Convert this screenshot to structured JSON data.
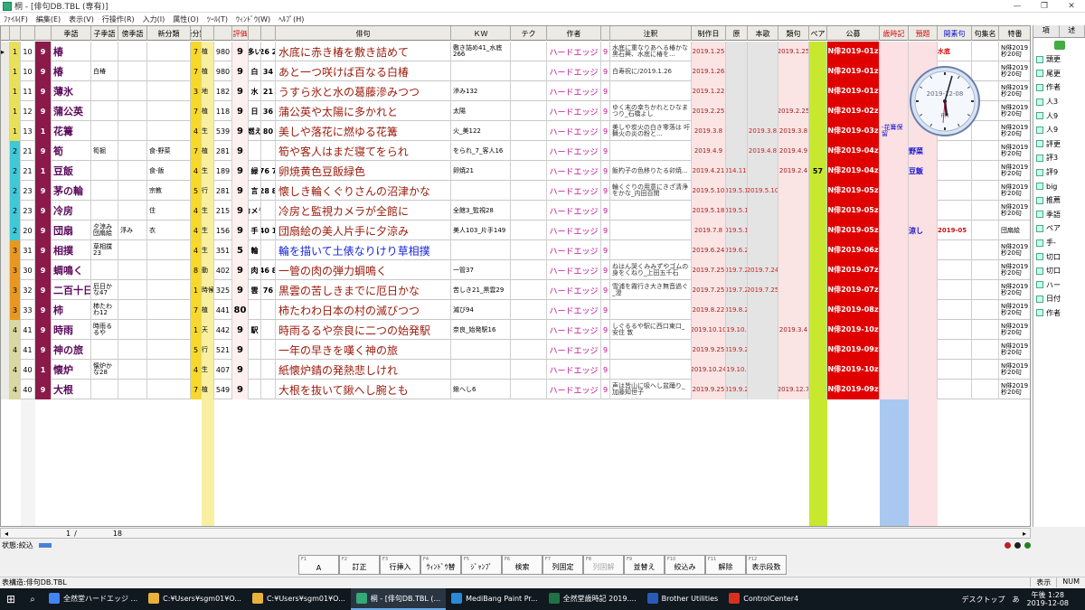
{
  "window": {
    "title": "桐 - [俳句DB.TBL (専有)]"
  },
  "menu": [
    "ﾌｧｲﾙ(F)",
    "編集(E)",
    "表示(V)",
    "行操作(R)",
    "入力(I)",
    "属性(O)",
    "ﾂｰﾙ(T)",
    "ｳｨﾝﾄﾞｳ(W)",
    "ﾍﾙﾌﾟ(H)"
  ],
  "columns": {
    "kigo": "季語",
    "kodai": "子季語",
    "bou": "傍季語",
    "bunrui": "新分類",
    "bunrui2": "新分類",
    "hyoka": "評価",
    "haiku": "俳句",
    "kw": "ＫＷ",
    "tech": "テク",
    "sakusha": "作者",
    "chushaku": "注釈",
    "sakusei": "制作日",
    "gen": "原",
    "honka": "本歌",
    "ruiku": "類句",
    "pair": "ペア",
    "koubo": "公募",
    "saijiki": "歳時記",
    "yodai": "預題",
    "kaiso": "開素句",
    "kushu": "句集名",
    "tokuban": "特番"
  },
  "rows": [
    {
      "a": "1",
      "b": "10",
      "k": "9",
      "kigo": "椿",
      "s1": "",
      "s2": "",
      "s3": "",
      "n": "7",
      "cat": "植",
      "cn": "980",
      "h": "9",
      "m1": "多い",
      "m2": "26 2",
      "haiku": "水底に赤き椿を敷き詰めて",
      "kw": "敷き詰め41_水底266",
      "sak": "ハードエッジ",
      "sn": "9",
      "chu": "水底に重なりあへる椿かな 黒石興、水底に椿を...",
      "date": "2019.1.25",
      "gen": "",
      "honka": "",
      "rui": "2019.1.25",
      "pair": "",
      "koubo": "N俳2019-01z",
      "sai": "",
      "yodai": "",
      "kaiso": "水底",
      "toku": "N俳2019秒20句"
    },
    {
      "a": "1",
      "b": "10",
      "k": "9",
      "kigo": "椿",
      "s1": "白椿",
      "s2": "",
      "s3": "",
      "n": "7",
      "cat": "植",
      "cn": "980",
      "h": "9",
      "m1": "白",
      "m2": "34",
      "haiku": "あと一つ咲けば百なる白椿",
      "kw": "",
      "sak": "ハードエッジ",
      "sn": "9",
      "chu": "白寿祝に/2019.1.26",
      "date": "2019.1.26",
      "gen": "",
      "honka": "",
      "rui": "",
      "pair": "",
      "koubo": "N俳2019-01z",
      "sai": "",
      "yodai": "",
      "kaiso": "",
      "toku": "N俳2019秒20句"
    },
    {
      "a": "1",
      "b": "11",
      "k": "9",
      "kigo": "薄氷",
      "s1": "",
      "s2": "",
      "s3": "",
      "n": "3",
      "cat": "地",
      "cn": "182",
      "h": "9",
      "m1": "水",
      "m2": "21",
      "haiku": "うすら氷と水の葛藤滲みつつ",
      "kw": "滲み132",
      "sak": "ハードエッジ",
      "sn": "9",
      "chu": "",
      "date": "2019.1.22",
      "gen": "",
      "honka": "",
      "rui": "",
      "pair": "",
      "koubo": "N俳2019-01z",
      "sai": "",
      "yodai": "",
      "kaiso": "",
      "toku": "N俳2019秒20句"
    },
    {
      "a": "1",
      "b": "12",
      "k": "9",
      "kigo": "蒲公英",
      "s1": "",
      "s2": "",
      "s3": "",
      "n": "7",
      "cat": "植",
      "cn": "118",
      "h": "9",
      "m1": "日",
      "m2": "36",
      "haiku": "蒲公英や太陽に多かれと",
      "kw": "太陽",
      "sak": "ハードエッジ",
      "sn": "9",
      "chu": "ゆく末の幸ちかれとひなまつり_石橋よし",
      "date": "2019.2.25",
      "gen": "",
      "honka": "",
      "rui": "2019.2.25",
      "pair": "",
      "koubo": "N俳2019-02z",
      "sai": "",
      "yodai": "",
      "kaiso": "",
      "toku": "N俳2019秒20句"
    },
    {
      "a": "1",
      "b": "13",
      "k": "1",
      "kigo": "花篝",
      "s1": "",
      "s2": "",
      "s3": "",
      "n": "4",
      "cat": "生",
      "cn": "539",
      "h": "9",
      "m1": "燃え",
      "m2": "80",
      "haiku": "美しや落花に燃ゆる花篝",
      "kw": "火_美122",
      "sak": "ハードエッジ",
      "sn": "9",
      "chu": "美しや炭火の白き零落は 吁 舞火の炎の粉と...",
      "date": "2019.3.8",
      "gen": "",
      "honka": "2019.3.8",
      "rui": "2019.3.8",
      "pair": "",
      "koubo": "N俳2019-03z",
      "sai": "-花篝保留",
      "yodai": "",
      "kaiso": "",
      "toku": "N俳2019秒20句"
    },
    {
      "a": "2",
      "b": "21",
      "k": "9",
      "kigo": "筍",
      "s1": "筍掘",
      "s2": "",
      "s3": "食-野菜",
      "n": "7",
      "cat": "植",
      "cn": "281",
      "h": "9",
      "m1": "",
      "m2": "",
      "haiku": "筍や客人はまだ寝てをられ",
      "kw": "をられ_7_客人16",
      "sak": "ハードエッジ",
      "sn": "9",
      "chu": "",
      "date": "2019.4.9",
      "gen": "",
      "honka": "2019.4.8",
      "rui": "2019.4.9",
      "pair": "",
      "koubo": "N俳2019-04z",
      "sai": "",
      "yodai": "野菜",
      "kaiso": "",
      "toku": "N俳2019秒20句"
    },
    {
      "a": "2",
      "b": "21",
      "k": "1",
      "kigo": "豆飯",
      "s1": "",
      "s2": "",
      "s3": "食-飯",
      "n": "4",
      "cat": "生",
      "cn": "189",
      "h": "9",
      "m1": "緑",
      "m2": "76 7",
      "haiku": "卵焼黄色豆飯緑色",
      "kw": "卵焼21",
      "sak": "ハードエッジ",
      "sn": "9",
      "chu": "飯杓子の色移りたる卯焼...",
      "date": "2019.4.21",
      "gen": "2014.11.1",
      "honka": "",
      "rui": "2019.2.4",
      "pair": "57",
      "koubo": "N俳2019-04z",
      "sai": "",
      "yodai": "豆飯",
      "kaiso": "",
      "toku": "N俳2019秒20句"
    },
    {
      "a": "2",
      "b": "23",
      "k": "9",
      "kigo": "茅の輪",
      "s1": "",
      "s2": "",
      "s3": "宗教",
      "n": "5",
      "cat": "行",
      "cn": "281",
      "h": "9",
      "m1": "言",
      "m2": "28 8",
      "haiku": "懐しき輪くぐりさんの沼津かな",
      "kw": "",
      "sak": "ハードエッジ",
      "sn": "9",
      "chu": "輪くぐりの用意にきざ清浄をかな_内田百閒",
      "date": "2019.5.10",
      "gen": "2019.5.10",
      "honka": "2019.5.10",
      "rui": "",
      "pair": "",
      "koubo": "N俳2019-05z",
      "sai": "",
      "yodai": "",
      "kaiso": "",
      "toku": "N俳2019秒20句"
    },
    {
      "a": "2",
      "b": "23",
      "k": "9",
      "kigo": "冷房",
      "s1": "",
      "s2": "",
      "s3": "住",
      "n": "4",
      "cat": "生",
      "cn": "215",
      "h": "9",
      "m1": "カメラ",
      "m2": "",
      "haiku": "冷房と監視カメラが全館に",
      "kw": "全館3_監視28",
      "sak": "ハードエッジ",
      "sn": "9",
      "chu": "",
      "date": "2019.5.18",
      "gen": "2019.5.18",
      "honka": "",
      "rui": "",
      "pair": "",
      "koubo": "N俳2019-05z",
      "sai": "",
      "yodai": "",
      "kaiso": "",
      "toku": "N俳2019秒20句"
    },
    {
      "a": "2",
      "b": "20",
      "k": "9",
      "kigo": "団扇",
      "s1": "夕涼み 団扇絵",
      "s2": "浮み",
      "s3": "衣",
      "n": "4",
      "cat": "生",
      "cn": "156",
      "h": "9",
      "m1": "手",
      "m2": "40 1",
      "haiku": "団扇絵の美人片手に夕涼み",
      "kw": "美人103_片手149",
      "sak": "ハードエッジ",
      "sn": "9",
      "chu": "",
      "date": "2019.7.8",
      "gen": "2019.5.12",
      "honka": "",
      "rui": "",
      "pair": "",
      "koubo": "N俳2019-05z",
      "sai": "",
      "yodai": "涼し",
      "kaiso": "2019-05",
      "toku": "団扇絵"
    },
    {
      "a": "3",
      "b": "31",
      "k": "9",
      "kigo": "相撲",
      "s1": "草相撲23",
      "s2": "",
      "s3": "",
      "n": "4",
      "cat": "生",
      "cn": "351",
      "h": "5",
      "m1": "輪",
      "m2": "",
      "haiku": "輪を描いて土俵なりけり草相撲",
      "kw": "",
      "sak": "ハードエッジ",
      "sn": "9",
      "chu": "",
      "date": "2019.6.24",
      "gen": "2019.6.24",
      "honka": "",
      "rui": "",
      "pair": "",
      "koubo": "N俳2019-06z",
      "sai": "",
      "yodai": "",
      "kaiso": "",
      "toku": "N俳2019秒20句"
    },
    {
      "a": "3",
      "b": "30",
      "k": "9",
      "kigo": "蜩鳴く",
      "s1": "",
      "s2": "",
      "s3": "",
      "n": "8",
      "cat": "動",
      "cn": "402",
      "h": "9",
      "m1": "肉",
      "m2": "46 8",
      "haiku": "一管の肉の弾力蜩鳴く",
      "kw": "一管37",
      "sak": "ハードエッジ",
      "sn": "9",
      "chu": "ねはん哭くみみずやゴムの身をくねり_上田五千石",
      "date": "2019.7.25",
      "gen": "2019.7.24",
      "honka": "2019.7.24",
      "rui": "",
      "pair": "",
      "koubo": "N俳2019-07z",
      "sai": "",
      "yodai": "",
      "kaiso": "",
      "toku": "N俳2019秒20句"
    },
    {
      "a": "3",
      "b": "32",
      "k": "9",
      "kigo": "二百十日",
      "s1": "厄日かな47",
      "s2": "",
      "s3": "",
      "n": "1",
      "cat": "時候",
      "cn": "325",
      "h": "9",
      "m1": "雲",
      "m2": "76",
      "haiku": "黒雲の苦しきまでに厄日かな",
      "kw": "苦しき21_黒雲29",
      "sak": "ハードエッジ",
      "sn": "9",
      "chu": "雪浦を霧行き大き無音過ぐ_澄",
      "date": "2019.7.25",
      "gen": "2019.7.25",
      "honka": "2019.7.25",
      "rui": "",
      "pair": "",
      "koubo": "N俳2019-07z",
      "sai": "",
      "yodai": "",
      "kaiso": "",
      "toku": "N俳2019秒20句"
    },
    {
      "a": "3",
      "b": "33",
      "k": "9",
      "kigo": "柿",
      "s1": "柿たわわ12",
      "s2": "",
      "s3": "",
      "n": "7",
      "cat": "植",
      "cn": "441",
      "h": "80",
      "m1": "",
      "m2": "",
      "haiku": "柿たわわ日本の村の滅びつつ",
      "kw": "滅び94",
      "sak": "ハードエッジ",
      "sn": "9",
      "chu": "",
      "date": "2019.8.22",
      "gen": "2019.8.22",
      "honka": "",
      "rui": "",
      "pair": "",
      "koubo": "N俳2019-08z",
      "sai": "",
      "yodai": "",
      "kaiso": "",
      "toku": "N俳2019秒20句"
    },
    {
      "a": "4",
      "b": "41",
      "k": "9",
      "kigo": "時雨",
      "s1": "時雨るるや",
      "s2": "",
      "s3": "",
      "n": "1",
      "cat": "天",
      "cn": "442",
      "h": "9",
      "m1": "駅",
      "m2": "",
      "haiku": "時雨るるや奈良に二つの始発駅",
      "kw": "奈良_始発駅16",
      "sak": "ハードエッジ",
      "sn": "9",
      "chu": "しぐるるや駅に西口東口_安住 敦",
      "date": "2019.10.10",
      "gen": "2019.10.10",
      "honka": "",
      "rui": "2019.3.4",
      "pair": "",
      "koubo": "N俳2019-10z",
      "sai": "",
      "yodai": "",
      "kaiso": "",
      "toku": "N俳2019秒20句"
    },
    {
      "a": "4",
      "b": "41",
      "k": "9",
      "kigo": "神の旅",
      "s1": "",
      "s2": "",
      "s3": "",
      "n": "5",
      "cat": "行",
      "cn": "521",
      "h": "9",
      "m1": "",
      "m2": "",
      "haiku": "一年の早きを嘆く神の旅",
      "kw": "",
      "sak": "ハードエッジ",
      "sn": "9",
      "chu": "",
      "date": "2019.9.25",
      "gen": "2019.9.25",
      "honka": "",
      "rui": "",
      "pair": "",
      "koubo": "N俳2019-09z",
      "sai": "",
      "yodai": "",
      "kaiso": "",
      "toku": "N俳2019秒20句"
    },
    {
      "a": "4",
      "b": "40",
      "k": "1",
      "kigo": "懐炉",
      "s1": "懐炉かな28",
      "s2": "",
      "s3": "",
      "n": "4",
      "cat": "生",
      "cn": "407",
      "h": "9",
      "m1": "",
      "m2": "",
      "haiku": "紙懐炉錆の発熱悲しけれ",
      "kw": "",
      "sak": "ハードエッジ",
      "sn": "9",
      "chu": "",
      "date": "2019.10.24",
      "gen": "2019.10.23",
      "honka": "",
      "rui": "",
      "pair": "",
      "koubo": "N俳2019-10z",
      "sai": "",
      "yodai": "",
      "kaiso": "",
      "toku": "N俳2019秒20句"
    },
    {
      "a": "4",
      "b": "40",
      "k": "9",
      "kigo": "大根",
      "s1": "",
      "s2": "",
      "s3": "",
      "n": "7",
      "cat": "植",
      "cn": "549",
      "h": "9",
      "m1": "",
      "m2": "",
      "haiku": "大根を抜いて鍬へし腕とも",
      "kw": "鍬へし6",
      "sak": "ハードエッジ",
      "sn": "9",
      "chu": "声は皆山に吸へし盆踊り_加藤知世子",
      "date": "2019.9.25",
      "gen": "2019.9.25",
      "honka": "",
      "rui": "2019.12.7",
      "pair": "",
      "koubo": "N俳2019-09z",
      "sai": "",
      "yodai": "",
      "kaiso": "",
      "toku": "N俳2019秒20句"
    }
  ],
  "sidebar": {
    "tabs": [
      "項",
      "述"
    ],
    "items": [
      "頭更",
      "尾更",
      "作者",
      "人3",
      "人9",
      "人9",
      "評更",
      "評3",
      "評9",
      "big",
      "推薦",
      "季語",
      "ペア",
      "手-",
      "切口",
      "切口",
      "ハー",
      "日付",
      "作者"
    ]
  },
  "clock": {
    "date": "2019-12-08",
    "period": "PM"
  },
  "nav": {
    "current": "1",
    "sep": "/",
    "total": "18"
  },
  "status": {
    "left": "状態:絞込",
    "table": "表構造:俳句DB.TBL"
  },
  "fkeys": [
    {
      "n": "F1",
      "l": "A",
      "d": false
    },
    {
      "n": "F2",
      "l": "訂正",
      "d": false
    },
    {
      "n": "F3",
      "l": "行挿入",
      "d": false
    },
    {
      "n": "F4",
      "l": "ｳｨﾝﾄﾞｳ替",
      "d": false
    },
    {
      "n": "F5",
      "l": "ｼﾞｬﾝﾌﾟ",
      "d": false
    },
    {
      "n": "F6",
      "l": "検索",
      "d": false
    },
    {
      "n": "F7",
      "l": "列固定",
      "d": false
    },
    {
      "n": "F8",
      "l": "列固解",
      "d": true
    },
    {
      "n": "F9",
      "l": "並替え",
      "d": false
    },
    {
      "n": "F10",
      "l": "絞込み",
      "d": false
    },
    {
      "n": "F11",
      "l": "解除",
      "d": false
    },
    {
      "n": "F12",
      "l": "表示段数",
      "d": false
    }
  ],
  "bottom": {
    "right": [
      "表示",
      "NUM"
    ]
  },
  "taskbar": {
    "items": [
      {
        "l": "全然堂ハードエッジ ...",
        "c": "#4285f4",
        "a": false
      },
      {
        "l": "C:¥Users¥sgm01¥O...",
        "c": "#e8b13a",
        "a": false
      },
      {
        "l": "C:¥Users¥sgm01¥O...",
        "c": "#e8b13a",
        "a": false
      },
      {
        "l": "桐 - [俳句DB.TBL (...",
        "c": "#3a7",
        "a": true
      },
      {
        "l": "MediBang Paint Pr...",
        "c": "#2a8ad8",
        "a": false
      },
      {
        "l": "全然堂歳時記 2019....",
        "c": "#207245",
        "a": false
      },
      {
        "l": "Brother Utilities",
        "c": "#2a5ab8",
        "a": false
      },
      {
        "l": "ControlCenter4",
        "c": "#d83020",
        "a": false
      }
    ],
    "desktop": "デスクトップ",
    "ime": "あ",
    "time": "午後 1:28",
    "date": "2019-12-08"
  }
}
